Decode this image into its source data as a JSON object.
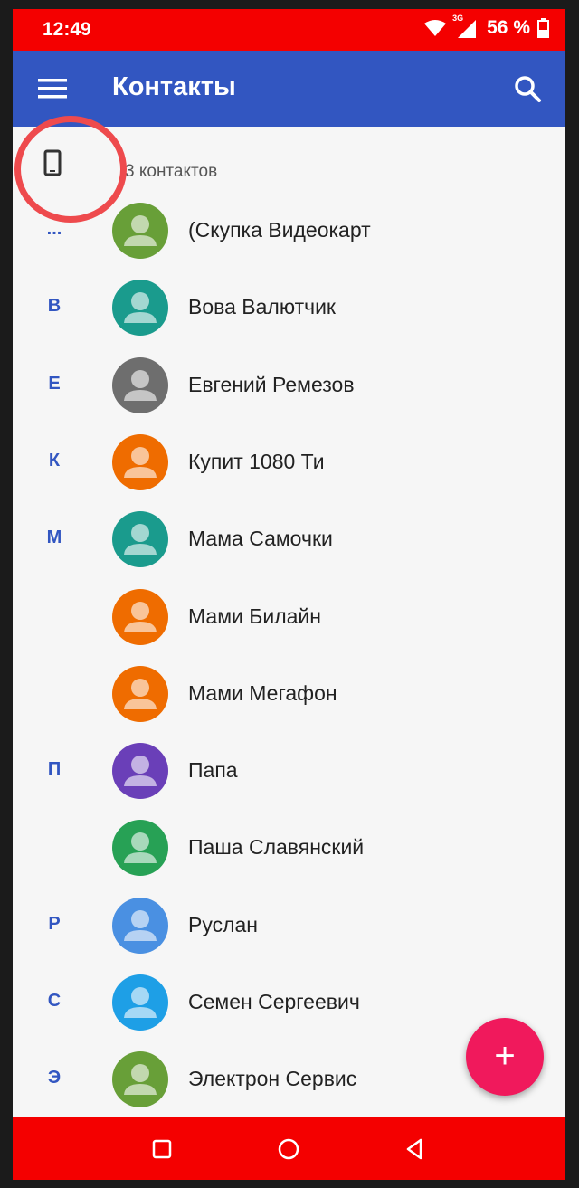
{
  "status_bar": {
    "time": "12:49",
    "network_label": "3G",
    "battery_text": "56 %"
  },
  "app_bar": {
    "title": "Контакты",
    "menu_icon": "hamburger-menu-icon",
    "search_icon": "search-icon"
  },
  "account": {
    "icon": "phone-device-icon",
    "count_text": "3 контактов"
  },
  "contacts": [
    {
      "letter": "...",
      "name": "(Скупка Видеокарт",
      "color": "#689f38"
    },
    {
      "letter": "В",
      "name": "Вова Валютчик",
      "color": "#1a9b8d"
    },
    {
      "letter": "Е",
      "name": "Евгений Ремезов",
      "color": "#6e6e6e"
    },
    {
      "letter": "К",
      "name": "Купит 1080 Ти",
      "color": "#ef6c00"
    },
    {
      "letter": "М",
      "name": "Мама Самочки",
      "color": "#1a9b8d"
    },
    {
      "letter": "",
      "name": "Мами Билайн",
      "color": "#ef6c00"
    },
    {
      "letter": "",
      "name": "Мами Мегафон",
      "color": "#ef6c00"
    },
    {
      "letter": "П",
      "name": "Папа",
      "color": "#6a3fb8"
    },
    {
      "letter": "",
      "name": "Паша Славянский",
      "color": "#27a155"
    },
    {
      "letter": "Р",
      "name": "Руслан",
      "color": "#4a90e2"
    },
    {
      "letter": "С",
      "name": "Семен Сергеевич",
      "color": "#1e9fe6"
    },
    {
      "letter": "Э",
      "name": "Электрон Сервис",
      "color": "#689f38"
    }
  ],
  "fab": {
    "label": "+",
    "icon": "add-contact-icon"
  },
  "nav_bar": {
    "icons": [
      "recents-square-icon",
      "home-circle-icon",
      "back-triangle-icon"
    ]
  },
  "colors": {
    "status_bar": "#f40000",
    "app_bar": "#3256c1",
    "letter_accent": "#3256c1",
    "fab": "#f0195c",
    "annotation": "#ee4a4d"
  }
}
